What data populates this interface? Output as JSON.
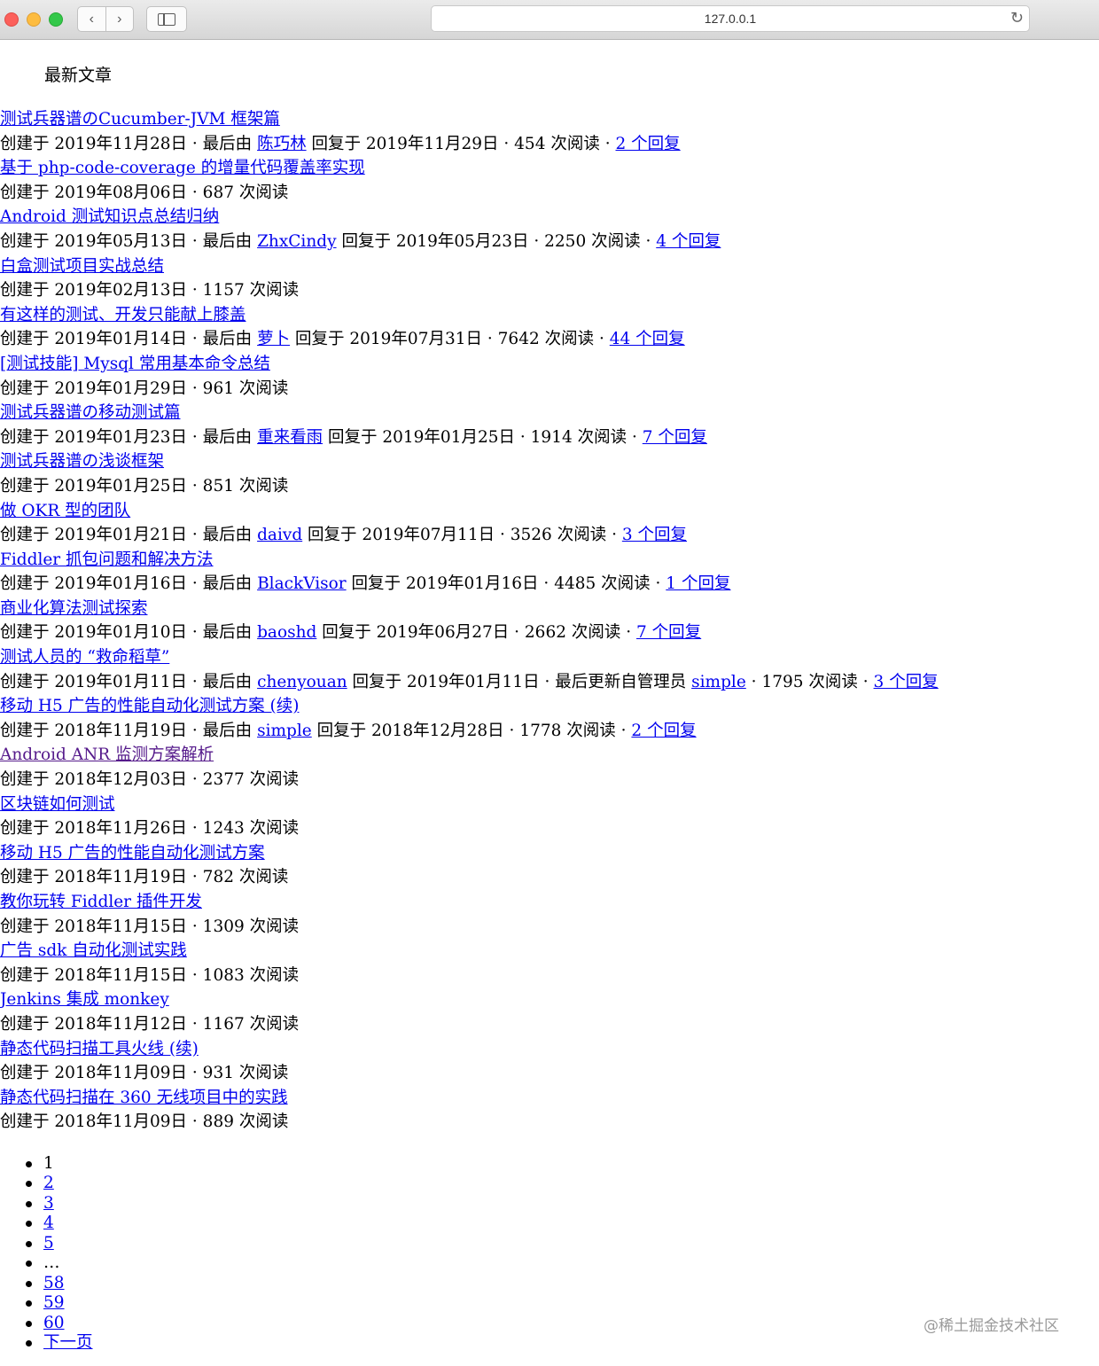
{
  "browser": {
    "url": "127.0.0.1",
    "back_glyph": "‹",
    "forward_glyph": "›",
    "reload_glyph": "↻"
  },
  "heading": "最新文章",
  "articles": [
    {
      "title": "测试兵器谱のCucumber-JVM 框架篇",
      "created": "创建于 2019年11月28日 · 最后由 ",
      "user": "陈巧林",
      "reply_info": " 回复于 2019年11月29日 · 454 次阅读 · ",
      "replies": "2 个回复"
    },
    {
      "title": "基于 php-code-coverage 的增量代码覆盖率实现",
      "created": "创建于 2019年08月06日 · 687 次阅读"
    },
    {
      "title": "Android 测试知识点总结归纳",
      "created": "创建于 2019年05月13日 · 最后由 ",
      "user": "ZhxCindy",
      "reply_info": " 回复于 2019年05月23日 · 2250 次阅读 · ",
      "replies": "4 个回复"
    },
    {
      "title": "白盒测试项目实战总结",
      "created": "创建于 2019年02月13日 · 1157 次阅读"
    },
    {
      "title": "有这样的测试、开发只能献上膝盖",
      "created": "创建于 2019年01月14日 · 最后由 ",
      "user": "萝卜",
      "reply_info": " 回复于 2019年07月31日 · 7642 次阅读 · ",
      "replies": "44 个回复"
    },
    {
      "title": "[测试技能] Mysql 常用基本命令总结",
      "created": "创建于 2019年01月29日 · 961 次阅读"
    },
    {
      "title": "测试兵器谱の移动测试篇",
      "created": "创建于 2019年01月23日 · 最后由 ",
      "user": "重来看雨",
      "reply_info": " 回复于 2019年01月25日 · 1914 次阅读 · ",
      "replies": "7 个回复"
    },
    {
      "title": "测试兵器谱の浅谈框架",
      "created": "创建于 2019年01月25日 · 851 次阅读"
    },
    {
      "title": "做 OKR 型的团队",
      "created": "创建于 2019年01月21日 · 最后由 ",
      "user": "daivd",
      "reply_info": " 回复于 2019年07月11日 · 3526 次阅读 · ",
      "replies": "3 个回复"
    },
    {
      "title": "Fiddler 抓包问题和解决方法",
      "created": "创建于 2019年01月16日 · 最后由 ",
      "user": "BlackVisor",
      "reply_info": " 回复于 2019年01月16日 · 4485 次阅读 · ",
      "replies": "1 个回复"
    },
    {
      "title": "商业化算法测试探索",
      "created": "创建于 2019年01月10日 · 最后由 ",
      "user": "baoshd",
      "reply_info": " 回复于 2019年06月27日 · 2662 次阅读 · ",
      "replies": "7 个回复"
    },
    {
      "title": "测试人员的 “救命稻草”",
      "created": "创建于 2019年01月11日 · 最后由 ",
      "user": "chenyouan",
      "reply_info": " 回复于 2019年01月11日 · 最后更新自管理员 ",
      "admin": "simple",
      "admin_info": " · 1795 次阅读 · ",
      "replies": "3 个回复"
    },
    {
      "title": "移动 H5 广告的性能自动化测试方案 (续)",
      "created": "创建于 2018年11月19日 · 最后由 ",
      "user": "simple",
      "reply_info": " 回复于 2018年12月28日 · 1778 次阅读 · ",
      "replies": "2 个回复"
    },
    {
      "title": "Android ANR 监测方案解析",
      "created": "创建于 2018年12月03日 · 2377 次阅读",
      "visited": true
    },
    {
      "title": "区块链如何测试",
      "created": "创建于 2018年11月26日 · 1243 次阅读"
    },
    {
      "title": "移动 H5 广告的性能自动化测试方案",
      "created": "创建于 2018年11月19日 · 782 次阅读"
    },
    {
      "title": "教你玩转 Fiddler 插件开发",
      "created": "创建于 2018年11月15日 · 1309 次阅读"
    },
    {
      "title": "广告 sdk 自动化测试实践",
      "created": "创建于 2018年11月15日 · 1083 次阅读"
    },
    {
      "title": "Jenkins 集成 monkey",
      "created": "创建于 2018年11月12日 · 1167 次阅读"
    },
    {
      "title": "静态代码扫描工具火线 (续)",
      "created": "创建于 2018年11月09日 · 931 次阅读"
    },
    {
      "title": "静态代码扫描在 360 无线项目中的实践",
      "created": "创建于 2018年11月09日 · 889 次阅读"
    }
  ],
  "pagination": [
    {
      "label": "1",
      "link": false
    },
    {
      "label": "2",
      "link": true
    },
    {
      "label": "3",
      "link": true
    },
    {
      "label": "4",
      "link": true
    },
    {
      "label": "5",
      "link": true
    },
    {
      "label": "…",
      "link": false
    },
    {
      "label": "58",
      "link": true
    },
    {
      "label": "59",
      "link": true
    },
    {
      "label": "60",
      "link": true
    },
    {
      "label": "下一页",
      "link": true
    }
  ],
  "watermark": "@稀土掘金技术社区"
}
